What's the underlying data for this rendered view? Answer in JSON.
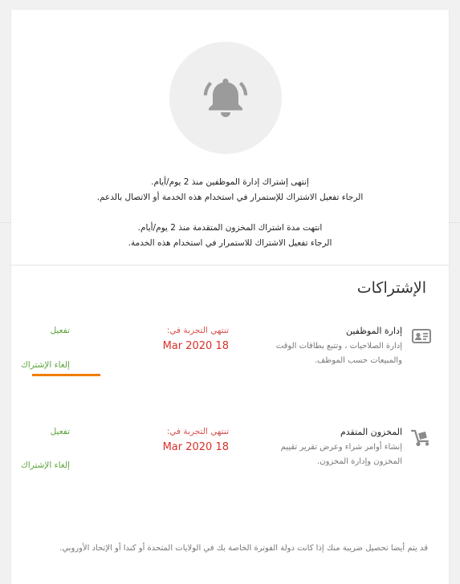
{
  "notifications": [
    {
      "line1": "إنتهى إشتراك إدارة الموظفين منذ 2 يوم/أيام.",
      "line2": "الرجاء تفعيل الاشتراك للإستمرار في استخدام هذه الخدمة أو الاتصال بالدعم."
    },
    {
      "line1": "انتهت مدة اشتراك المخزون المتقدمة منذ 2 يوم/أيام.",
      "line2": "الرجاء تفعيل الاشتراك للاستمرار في استخدام هذه الخدمة."
    }
  ],
  "section_title": "الإشتراكات",
  "subscriptions": [
    {
      "name": "إدارة الموظفين",
      "description": "إدارة الصلاحيات ، وتتبع بطاقات الوقت والمبيعات حسب الموظف.",
      "expiry_label": "تنتهي التجربة في:",
      "expiry_date": "Mar 2020 18",
      "activate_label": "تفعيل",
      "cancel_label": "إلغاء الإشتراك",
      "icon": "id-card-icon"
    },
    {
      "name": "المخزون المتقدم",
      "description": "إنشاء أوامر شراء وعرض تقرير تقييم المخزون وإدارة المخزون.",
      "expiry_label": "تنتهي التجربة في:",
      "expiry_date": "Mar 2020 18",
      "activate_label": "تفعيل",
      "cancel_label": "إلغاء الإشتراك",
      "icon": "hand-truck-icon"
    }
  ],
  "footer_note": "قد يتم أيضا تحصيل ضريبة منك إذا كانت دولة الفوترة الخاصة بك في الولايات المتحدة أو كندا أو الإتحاد الأوروبي.",
  "colors": {
    "accent_green": "#5ea53d",
    "expiry_red": "#d9302a",
    "underline_orange": "#f07d00",
    "icon_gray": "#8a8a8a"
  }
}
